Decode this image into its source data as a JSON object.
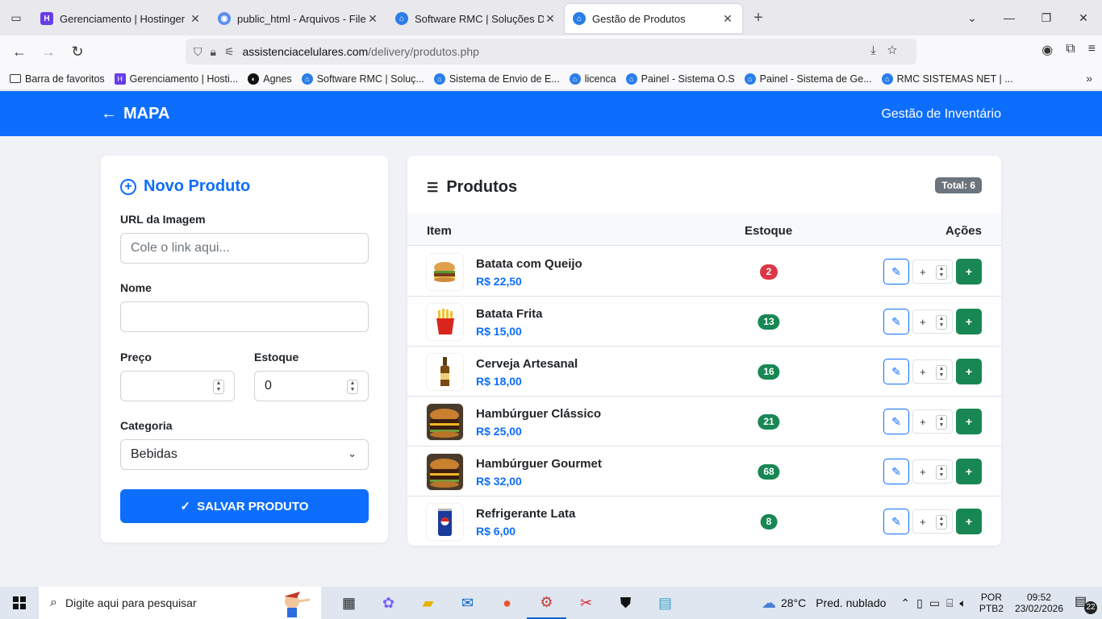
{
  "browser": {
    "tabs": [
      {
        "title": "Gerenciamento | Hostinger",
        "icon": "hostinger-icon",
        "active": false
      },
      {
        "title": "public_html - Arquivos - File Bro",
        "icon": "globe-icon",
        "active": false
      },
      {
        "title": "Software RMC | Soluções Digita",
        "icon": "house-icon",
        "active": false
      },
      {
        "title": "Gestão de Produtos",
        "icon": "house-icon",
        "active": true
      }
    ],
    "url_host": "assistenciacelulares.com",
    "url_path": "/delivery/produtos.php",
    "bookmarks": [
      {
        "label": "Barra de favoritos",
        "icon": "folder-icon"
      },
      {
        "label": "Gerenciamento | Hosti...",
        "icon": "hostinger-icon"
      },
      {
        "label": "Agnes",
        "icon": "agnes-icon"
      },
      {
        "label": "Software RMC | Soluç...",
        "icon": "house-icon"
      },
      {
        "label": "Sistema de Envio de E...",
        "icon": "house-icon"
      },
      {
        "label": "licenca",
        "icon": "house-icon"
      },
      {
        "label": "Painel - Sistema O.S",
        "icon": "house-icon"
      },
      {
        "label": "Painel - Sistema de Ge...",
        "icon": "house-icon"
      },
      {
        "label": "RMC SISTEMAS NET | ...",
        "icon": "house-icon"
      }
    ]
  },
  "header": {
    "brand": "MAPA",
    "right_label": "Gestão de Inventário"
  },
  "form": {
    "title": "Novo Produto",
    "image_label": "URL da Imagem",
    "image_placeholder": "Cole o link aqui...",
    "name_label": "Nome",
    "name_value": "",
    "price_label": "Preço",
    "price_value": "",
    "stock_label": "Estoque",
    "stock_value": "0",
    "category_label": "Categoria",
    "category_value": "Bebidas",
    "save_label": "SALVAR PRODUTO"
  },
  "products": {
    "title": "Produtos",
    "total": "Total: 6",
    "col_item": "Item",
    "col_stock": "Estoque",
    "col_actions": "Ações",
    "qty_placeholder": "+",
    "add_label": "+",
    "items": [
      {
        "name": "Batata com Queijo",
        "price": "R$ 22,50",
        "stock": "2",
        "stock_status": "low",
        "thumb": "burger-icon"
      },
      {
        "name": "Batata Frita",
        "price": "R$ 15,00",
        "stock": "13",
        "stock_status": "ok",
        "thumb": "fries-icon"
      },
      {
        "name": "Cerveja Artesanal",
        "price": "R$ 18,00",
        "stock": "16",
        "stock_status": "ok",
        "thumb": "beer-bottle-icon"
      },
      {
        "name": "Hambúrguer Clássico",
        "price": "R$ 25,00",
        "stock": "21",
        "stock_status": "ok",
        "thumb": "burger-photo"
      },
      {
        "name": "Hambúrguer Gourmet",
        "price": "R$ 32,00",
        "stock": "68",
        "stock_status": "ok",
        "thumb": "burger-photo"
      },
      {
        "name": "Refrigerante Lata",
        "price": "R$ 6,00",
        "stock": "8",
        "stock_status": "ok",
        "thumb": "soda-can-icon"
      }
    ]
  },
  "colors": {
    "primary": "#0d6efd",
    "success": "#198754",
    "danger": "#dc3545",
    "secondary": "#6c757d"
  },
  "taskbar": {
    "search_placeholder": "Digite aqui para pesquisar",
    "weather_temp": "28°C",
    "weather_desc": "Pred. nublado",
    "weather_alert": "1",
    "lang_top": "POR",
    "lang_bottom": "PTB2",
    "time": "09:52",
    "date": "23/02/2026",
    "notifications": "22"
  }
}
